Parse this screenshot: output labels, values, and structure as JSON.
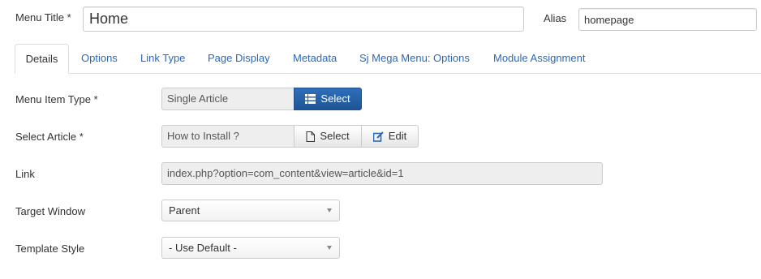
{
  "title_field": {
    "label": "Menu Title *",
    "value": "Home"
  },
  "alias_field": {
    "label": "Alias",
    "value": "homepage"
  },
  "tabs": [
    {
      "label": "Details",
      "active": true
    },
    {
      "label": "Options"
    },
    {
      "label": "Link Type"
    },
    {
      "label": "Page Display"
    },
    {
      "label": "Metadata"
    },
    {
      "label": "Sj Mega Menu: Options"
    },
    {
      "label": "Module Assignment"
    }
  ],
  "form": {
    "menu_item_type": {
      "label": "Menu Item Type *",
      "value": "Single Article",
      "select_label": "Select"
    },
    "select_article": {
      "label": "Select Article *",
      "value": "How to Install ?",
      "select_label": "Select",
      "edit_label": "Edit"
    },
    "link": {
      "label": "Link",
      "value": "index.php?option=com_content&view=article&id=1"
    },
    "target_window": {
      "label": "Target Window",
      "value": "Parent"
    },
    "template_style": {
      "label": "Template Style",
      "value": "- Use Default -"
    }
  },
  "colors": {
    "link_blue": "#2a69b8",
    "primary_button": "#2462ac"
  }
}
